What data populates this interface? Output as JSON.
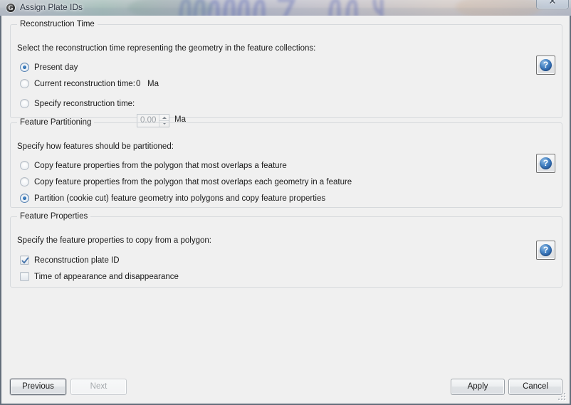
{
  "window": {
    "title": "Assign Plate IDs",
    "icon": "gplates-logo-icon",
    "icon_glyph": "G",
    "close_glyph": "✕"
  },
  "groups": [
    {
      "title": "Reconstruction Time",
      "prompt": "Select the reconstruction time representing the geometry in the feature collections:",
      "help_glyph": "?",
      "options": [
        {
          "label": "Present day",
          "checked": true
        },
        {
          "label": "Current reconstruction time:",
          "checked": false,
          "value": "0",
          "unit": "Ma"
        },
        {
          "label": "Specify reconstruction time:",
          "checked": false,
          "spin_value": "0.00",
          "unit": "Ma"
        }
      ]
    },
    {
      "title": "Feature Partitioning",
      "prompt": "Specify how features should be partitioned:",
      "help_glyph": "?",
      "options": [
        {
          "label": "Copy feature properties from the polygon that most overlaps a feature",
          "checked": false
        },
        {
          "label": "Copy feature properties from the polygon that most overlaps each geometry in a feature",
          "checked": false
        },
        {
          "label": "Partition (cookie cut) feature geometry into polygons and copy feature properties",
          "checked": true
        }
      ]
    },
    {
      "title": "Feature Properties",
      "prompt": "Specify the feature properties to copy from a polygon:",
      "help_glyph": "?",
      "checkboxes": [
        {
          "label": "Reconstruction plate ID",
          "checked": true
        },
        {
          "label": "Time of appearance and disappearance",
          "checked": false
        }
      ]
    }
  ],
  "buttons": {
    "previous": "Previous",
    "next": "Next",
    "apply": "Apply",
    "cancel": "Cancel"
  },
  "colors": {
    "accent_blue": "#2a62a8",
    "window_bg": "#f0f0f0",
    "border": "#636e7b"
  }
}
